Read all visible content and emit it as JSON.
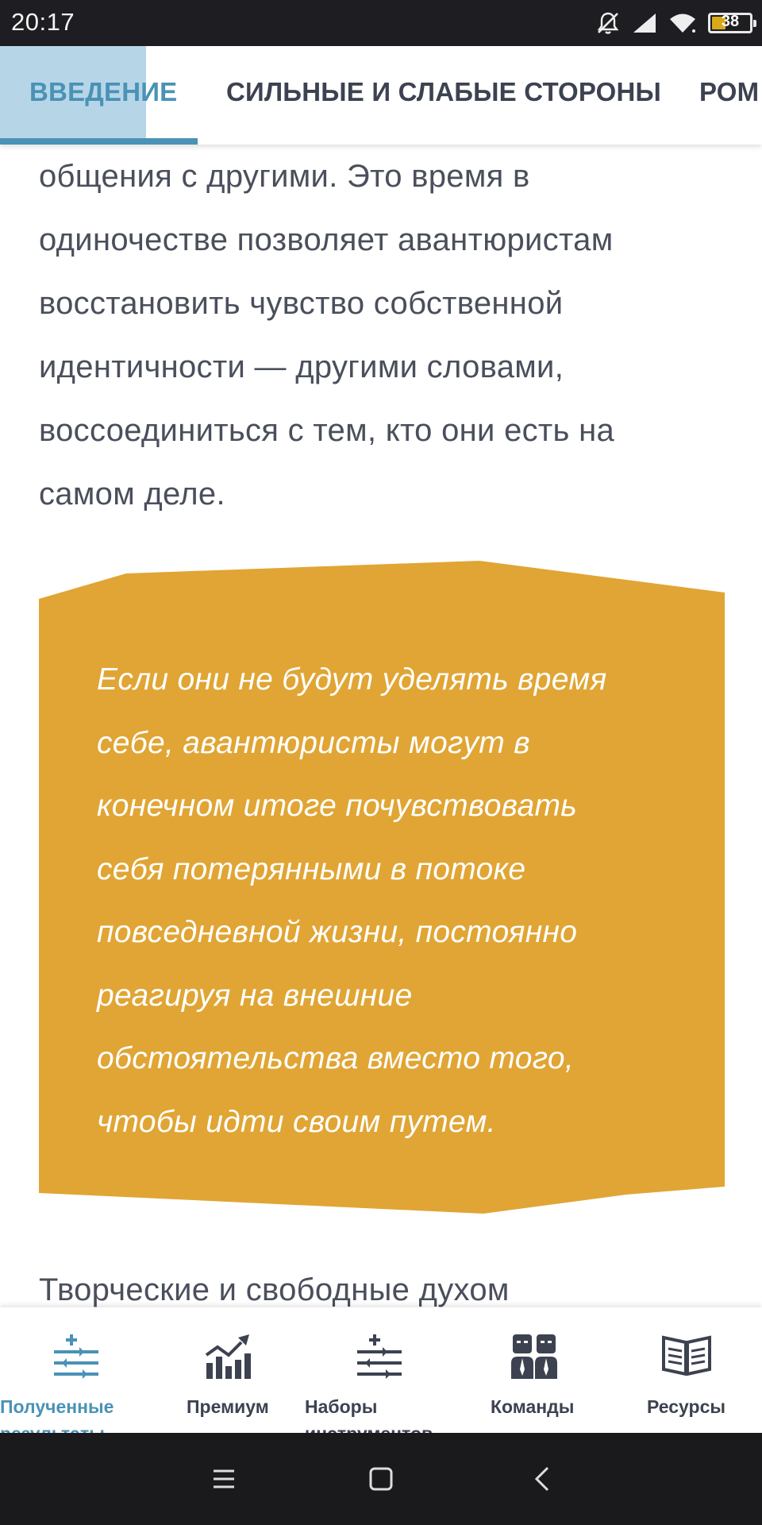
{
  "status_bar": {
    "time": "20:17",
    "battery_level": "38",
    "battery_fraction": 0.38,
    "icons": [
      "bell-off-icon",
      "cellular-signal-icon",
      "wifi-icon",
      "battery-icon"
    ]
  },
  "tabs": [
    {
      "label": "ВВЕДЕНИЕ",
      "active": true
    },
    {
      "label": "СИЛЬНЫЕ И СЛАБЫЕ СТОРОНЫ",
      "active": false
    },
    {
      "label": "РОМ",
      "active": false
    }
  ],
  "article": {
    "paragraph_lines": [
      "общения с другими. Это время в",
      "одиночестве позволяет авантюристам",
      "восстановить чувство собственной",
      "идентичности — другими словами,",
      "воссоединиться с тем, кто они есть на",
      "самом деле."
    ],
    "quote_lines": [
      "Если они не будут уделять время",
      "себе, авантюристы могут в",
      "конечном итоге почувствовать",
      "себя потерянными в потоке",
      "повседневной жизни, постоянно",
      "реагируя на внешние",
      "обстоятельства вместо того,",
      "чтобы идти своим путем."
    ],
    "next_paragraph_start": "Творческие и свободные духом"
  },
  "bottom_nav": [
    {
      "label_lines": [
        "Полученные",
        "результаты"
      ],
      "icon": "sliders-plus-icon",
      "active": true
    },
    {
      "label_lines": [
        "Премиум"
      ],
      "icon": "bar-chart-trend-icon",
      "active": false
    },
    {
      "label_lines": [
        "Наборы",
        "инструментов"
      ],
      "icon": "sliders-plus-icon",
      "active": false
    },
    {
      "label_lines": [
        "Команды"
      ],
      "icon": "team-people-icon",
      "active": false
    },
    {
      "label_lines": [
        "Ресурсы"
      ],
      "icon": "open-book-icon",
      "active": false
    }
  ],
  "system_nav": {
    "buttons": [
      "menu-icon",
      "home-square-icon",
      "back-chevron-icon"
    ]
  },
  "colors": {
    "accent": "#4a92b6",
    "tab_highlight": "#b6d6e8",
    "quote_background": "#e0a534",
    "body_text": "#4a4f5c",
    "status_bar": "#1e1e22"
  }
}
